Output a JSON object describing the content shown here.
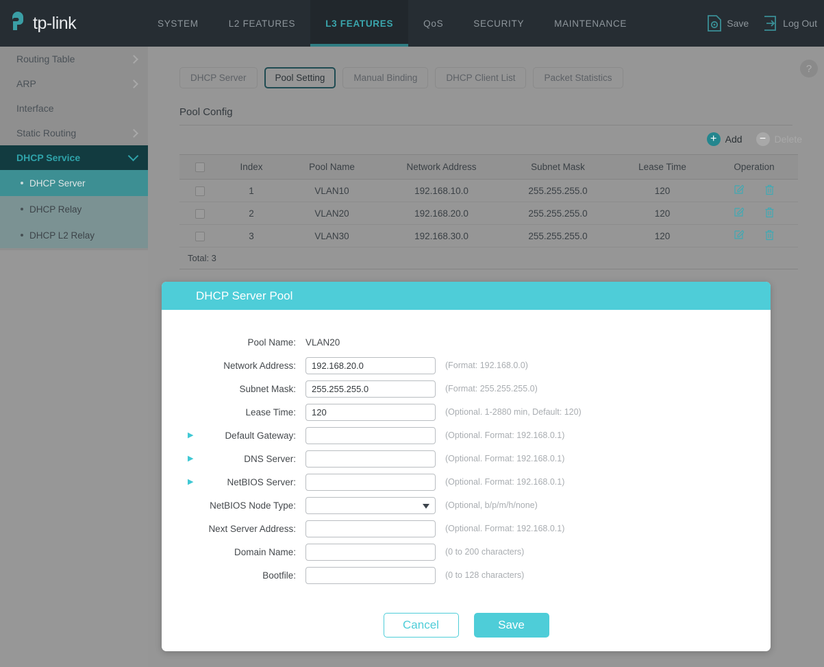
{
  "brand": {
    "name": "tp-link",
    "logo_icon": "tplink-logo-icon"
  },
  "topnav": {
    "items": [
      {
        "label": "SYSTEM",
        "active": false
      },
      {
        "label": "L2 FEATURES",
        "active": false
      },
      {
        "label": "L3 FEATURES",
        "active": true
      },
      {
        "label": "QoS",
        "active": false
      },
      {
        "label": "SECURITY",
        "active": false
      },
      {
        "label": "MAINTENANCE",
        "active": false
      }
    ],
    "save_label": "Save",
    "save_icon": "save-document-gear-icon",
    "logout_label": "Log Out",
    "logout_icon": "logout-arrow-icon"
  },
  "sidebar": {
    "items": [
      {
        "label": "Routing Table",
        "expandable": true
      },
      {
        "label": "ARP",
        "expandable": true
      },
      {
        "label": "Interface",
        "expandable": false
      },
      {
        "label": "Static Routing",
        "expandable": true
      },
      {
        "label": "DHCP Service",
        "expandable": true,
        "open": true
      }
    ],
    "subitems": [
      {
        "label": "DHCP Server",
        "selected": true
      },
      {
        "label": "DHCP Relay",
        "selected": false
      },
      {
        "label": "DHCP L2 Relay",
        "selected": false
      }
    ]
  },
  "content": {
    "help_icon": "help-question-icon",
    "tabs": [
      {
        "label": "DHCP Server",
        "active": false
      },
      {
        "label": "Pool Setting",
        "active": true
      },
      {
        "label": "Manual Binding",
        "active": false
      },
      {
        "label": "DHCP Client List",
        "active": false
      },
      {
        "label": "Packet Statistics",
        "active": false
      }
    ],
    "section_title": "Pool Config",
    "toolbar": {
      "add_label": "Add",
      "add_icon": "plus-circle-icon",
      "delete_label": "Delete",
      "delete_icon": "minus-circle-icon"
    },
    "table": {
      "columns": [
        "",
        "Index",
        "Pool Name",
        "Network Address",
        "Subnet Mask",
        "Lease Time",
        "Operation"
      ],
      "rows": [
        {
          "index": "1",
          "pool_name": "VLAN10",
          "network_address": "192.168.10.0",
          "subnet_mask": "255.255.255.0",
          "lease_time": "120"
        },
        {
          "index": "2",
          "pool_name": "VLAN20",
          "network_address": "192.168.20.0",
          "subnet_mask": "255.255.255.0",
          "lease_time": "120"
        },
        {
          "index": "3",
          "pool_name": "VLAN30",
          "network_address": "192.168.30.0",
          "subnet_mask": "255.255.255.0",
          "lease_time": "120"
        }
      ],
      "edit_icon": "edit-pencil-icon",
      "delete_icon": "trash-bin-icon",
      "total": "Total: 3"
    }
  },
  "modal": {
    "title": "DHCP Server Pool",
    "fields": [
      {
        "label": "Pool Name:",
        "type": "static",
        "value": "VLAN20",
        "hint": "",
        "caret": false
      },
      {
        "label": "Network Address:",
        "type": "input",
        "value": "192.168.20.0",
        "hint": "(Format: 192.168.0.0)",
        "caret": false
      },
      {
        "label": "Subnet Mask:",
        "type": "input",
        "value": "255.255.255.0",
        "hint": "(Format: 255.255.255.0)",
        "caret": false
      },
      {
        "label": "Lease Time:",
        "type": "input",
        "value": "120",
        "hint": "(Optional. 1-2880 min, Default: 120)",
        "caret": false
      },
      {
        "label": "Default Gateway:",
        "type": "input",
        "value": "",
        "hint": "(Optional. Format: 192.168.0.1)",
        "caret": true
      },
      {
        "label": "DNS Server:",
        "type": "input",
        "value": "",
        "hint": "(Optional. Format: 192.168.0.1)",
        "caret": true
      },
      {
        "label": "NetBIOS Server:",
        "type": "input",
        "value": "",
        "hint": "(Optional. Format: 192.168.0.1)",
        "caret": true
      },
      {
        "label": "NetBIOS Node Type:",
        "type": "select",
        "value": "",
        "hint": "(Optional, b/p/m/h/none)",
        "caret": false
      },
      {
        "label": "Next Server Address:",
        "type": "input",
        "value": "",
        "hint": "(Optional. Format: 192.168.0.1)",
        "caret": false
      },
      {
        "label": "Domain Name:",
        "type": "input",
        "value": "",
        "hint": "(0 to 200 characters)",
        "caret": false
      },
      {
        "label": "Bootfile:",
        "type": "input",
        "value": "",
        "hint": "(0 to 128 characters)",
        "caret": false
      }
    ],
    "cancel_label": "Cancel",
    "save_label": "Save"
  },
  "colors": {
    "brand_teal": "#4ecdd8",
    "nav_bg": "#262d33",
    "nav_active": "#3aa6ad",
    "overlay_grey": "#969696",
    "add_teal": "#24868e"
  }
}
